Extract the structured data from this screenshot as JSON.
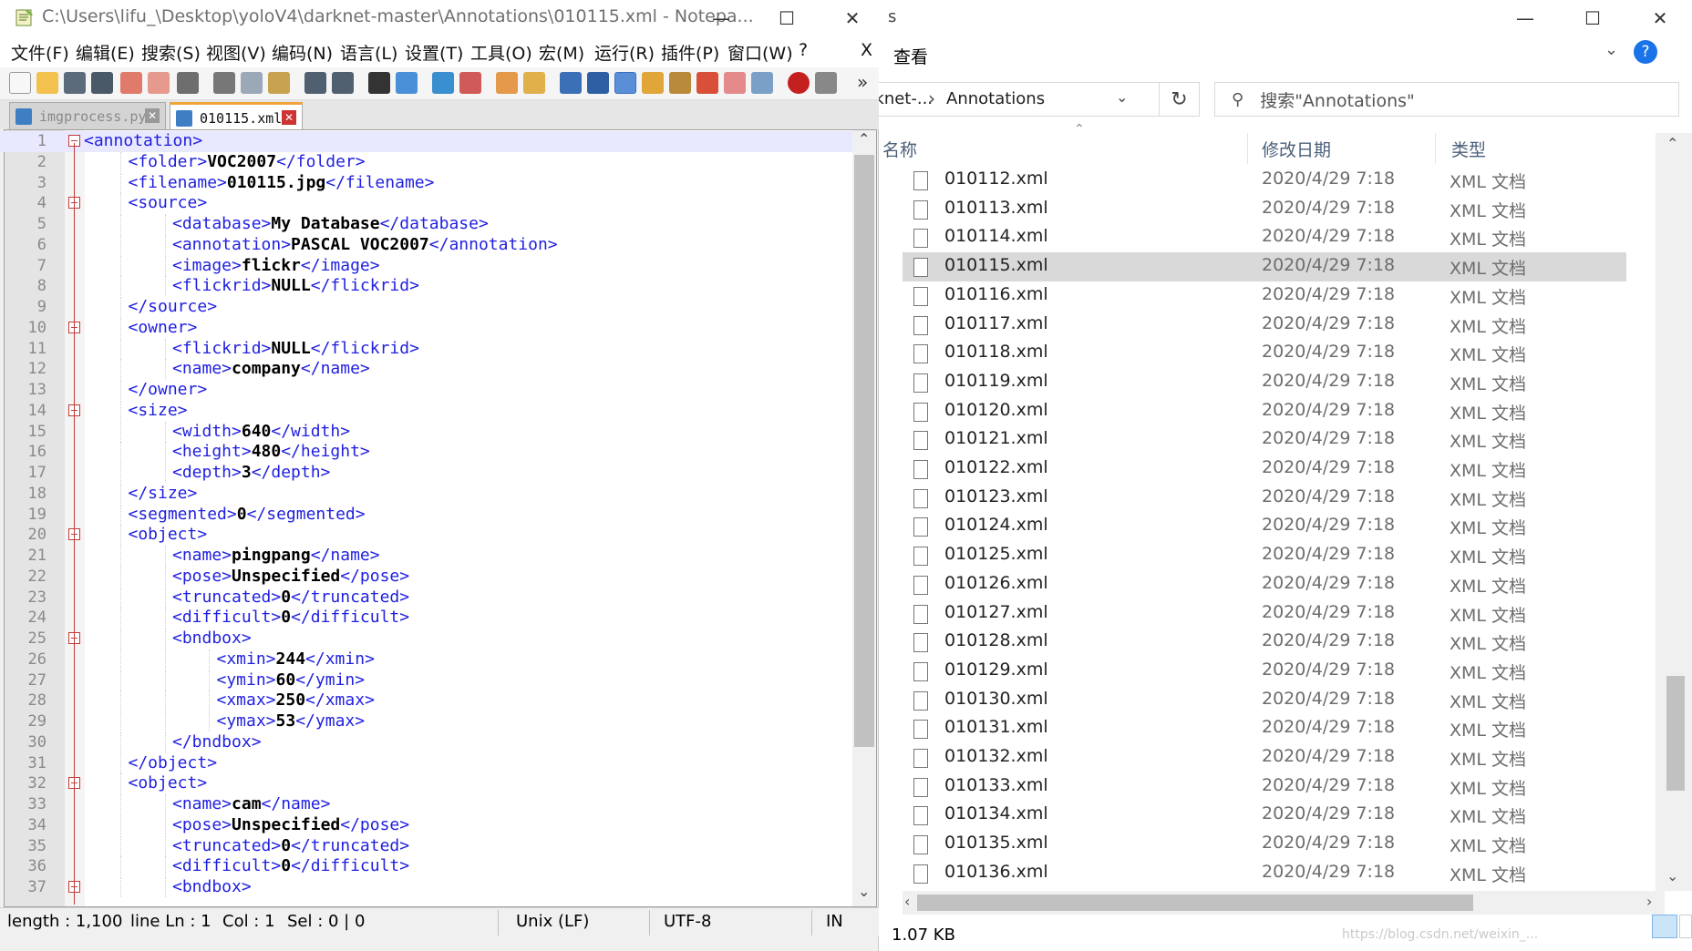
{
  "notepad": {
    "title": "C:\\Users\\lifu_\\Desktop\\yoloV4\\darknet-master\\Annotations\\010115.xml - Notepa...",
    "menu": [
      "文件(F)",
      "编辑(E)",
      "搜索(S)",
      "视图(V)",
      "编码(N)",
      "语言(L)",
      "设置(T)",
      "工具(O)",
      "宏(M)",
      "运行(R)",
      "插件(P)",
      "窗口(W)",
      "?"
    ],
    "menu_close": "X",
    "toolbar_overflow": "»",
    "tabs": [
      {
        "label": "imgprocess.py",
        "active": false
      },
      {
        "label": "010115.xml",
        "active": true
      }
    ],
    "lines": [
      {
        "n": "1",
        "open": "<annotation>",
        "val": "",
        "close": "",
        "indent": 0,
        "fold": true
      },
      {
        "n": "2",
        "open": "<folder>",
        "val": "VOC2007",
        "close": "</folder>",
        "indent": 1
      },
      {
        "n": "3",
        "open": "<filename>",
        "val": "010115.jpg",
        "close": "</filename>",
        "indent": 1
      },
      {
        "n": "4",
        "open": "<source>",
        "val": "",
        "close": "",
        "indent": 1,
        "fold": true
      },
      {
        "n": "5",
        "open": "<database>",
        "val": "My Database",
        "close": "</database>",
        "indent": 2
      },
      {
        "n": "6",
        "open": "<annotation>",
        "val": "PASCAL VOC2007",
        "close": "</annotation>",
        "indent": 2
      },
      {
        "n": "7",
        "open": "<image>",
        "val": "flickr",
        "close": "</image>",
        "indent": 2
      },
      {
        "n": "8",
        "open": "<flickrid>",
        "val": "NULL",
        "close": "</flickrid>",
        "indent": 2
      },
      {
        "n": "9",
        "open": "",
        "val": "",
        "close": "</source>",
        "indent": 1
      },
      {
        "n": "10",
        "open": "<owner>",
        "val": "",
        "close": "",
        "indent": 1,
        "fold": true
      },
      {
        "n": "11",
        "open": "<flickrid>",
        "val": "NULL",
        "close": "</flickrid>",
        "indent": 2
      },
      {
        "n": "12",
        "open": "<name>",
        "val": "company",
        "close": "</name>",
        "indent": 2
      },
      {
        "n": "13",
        "open": "",
        "val": "",
        "close": "</owner>",
        "indent": 1
      },
      {
        "n": "14",
        "open": "<size>",
        "val": "",
        "close": "",
        "indent": 1,
        "fold": true
      },
      {
        "n": "15",
        "open": "<width>",
        "val": "640",
        "close": "</width>",
        "indent": 2
      },
      {
        "n": "16",
        "open": "<height>",
        "val": "480",
        "close": "</height>",
        "indent": 2
      },
      {
        "n": "17",
        "open": "<depth>",
        "val": "3",
        "close": "</depth>",
        "indent": 2
      },
      {
        "n": "18",
        "open": "",
        "val": "",
        "close": "</size>",
        "indent": 1
      },
      {
        "n": "19",
        "open": "<segmented>",
        "val": "0",
        "close": "</segmented>",
        "indent": 1
      },
      {
        "n": "20",
        "open": "<object>",
        "val": "",
        "close": "",
        "indent": 1,
        "fold": true
      },
      {
        "n": "21",
        "open": "<name>",
        "val": "pingpang",
        "close": "</name>",
        "indent": 2
      },
      {
        "n": "22",
        "open": "<pose>",
        "val": "Unspecified",
        "close": "</pose>",
        "indent": 2
      },
      {
        "n": "23",
        "open": "<truncated>",
        "val": "0",
        "close": "</truncated>",
        "indent": 2
      },
      {
        "n": "24",
        "open": "<difficult>",
        "val": "0",
        "close": "</difficult>",
        "indent": 2
      },
      {
        "n": "25",
        "open": "<bndbox>",
        "val": "",
        "close": "",
        "indent": 2,
        "fold": true
      },
      {
        "n": "26",
        "open": "<xmin>",
        "val": "244",
        "close": "</xmin>",
        "indent": 3
      },
      {
        "n": "27",
        "open": "<ymin>",
        "val": "60",
        "close": "</ymin>",
        "indent": 3
      },
      {
        "n": "28",
        "open": "<xmax>",
        "val": "250",
        "close": "</xmax>",
        "indent": 3
      },
      {
        "n": "29",
        "open": "<ymax>",
        "val": "53",
        "close": "</ymax>",
        "indent": 3
      },
      {
        "n": "30",
        "open": "",
        "val": "",
        "close": "</bndbox>",
        "indent": 2
      },
      {
        "n": "31",
        "open": "",
        "val": "",
        "close": "</object>",
        "indent": 1
      },
      {
        "n": "32",
        "open": "<object>",
        "val": "",
        "close": "",
        "indent": 1,
        "fold": true
      },
      {
        "n": "33",
        "open": "<name>",
        "val": "cam",
        "close": "</name>",
        "indent": 2
      },
      {
        "n": "34",
        "open": "<pose>",
        "val": "Unspecified",
        "close": "</pose>",
        "indent": 2
      },
      {
        "n": "35",
        "open": "<truncated>",
        "val": "0",
        "close": "</truncated>",
        "indent": 2
      },
      {
        "n": "36",
        "open": "<difficult>",
        "val": "0",
        "close": "</difficult>",
        "indent": 2
      },
      {
        "n": "37",
        "open": "<bndbox>",
        "val": "",
        "close": "",
        "indent": 2,
        "fold": true
      }
    ],
    "status": {
      "length": "length : 1,100",
      "line": "line Ln : 1",
      "col": "Col : 1",
      "sel": "Sel : 0 | 0",
      "eol": "Unix (LF)",
      "encoding": "UTF-8",
      "mode": "IN"
    }
  },
  "explorer": {
    "title_fragment": "s",
    "ribbon_view": "查看",
    "breadcrumb_prev": "rknet-...",
    "breadcrumb_sep": "›",
    "breadcrumb_current": "Annotations",
    "search_placeholder": "搜索\"Annotations\"",
    "columns": {
      "name": "名称",
      "date": "修改日期",
      "type": "类型"
    },
    "files": [
      {
        "name": "010112.xml",
        "date": "2020/4/29 7:18",
        "type": "XML 文档"
      },
      {
        "name": "010113.xml",
        "date": "2020/4/29 7:18",
        "type": "XML 文档"
      },
      {
        "name": "010114.xml",
        "date": "2020/4/29 7:18",
        "type": "XML 文档"
      },
      {
        "name": "010115.xml",
        "date": "2020/4/29 7:18",
        "type": "XML 文档",
        "selected": true
      },
      {
        "name": "010116.xml",
        "date": "2020/4/29 7:18",
        "type": "XML 文档"
      },
      {
        "name": "010117.xml",
        "date": "2020/4/29 7:18",
        "type": "XML 文档"
      },
      {
        "name": "010118.xml",
        "date": "2020/4/29 7:18",
        "type": "XML 文档"
      },
      {
        "name": "010119.xml",
        "date": "2020/4/29 7:18",
        "type": "XML 文档"
      },
      {
        "name": "010120.xml",
        "date": "2020/4/29 7:18",
        "type": "XML 文档"
      },
      {
        "name": "010121.xml",
        "date": "2020/4/29 7:18",
        "type": "XML 文档"
      },
      {
        "name": "010122.xml",
        "date": "2020/4/29 7:18",
        "type": "XML 文档"
      },
      {
        "name": "010123.xml",
        "date": "2020/4/29 7:18",
        "type": "XML 文档"
      },
      {
        "name": "010124.xml",
        "date": "2020/4/29 7:18",
        "type": "XML 文档"
      },
      {
        "name": "010125.xml",
        "date": "2020/4/29 7:18",
        "type": "XML 文档"
      },
      {
        "name": "010126.xml",
        "date": "2020/4/29 7:18",
        "type": "XML 文档"
      },
      {
        "name": "010127.xml",
        "date": "2020/4/29 7:18",
        "type": "XML 文档"
      },
      {
        "name": "010128.xml",
        "date": "2020/4/29 7:18",
        "type": "XML 文档"
      },
      {
        "name": "010129.xml",
        "date": "2020/4/29 7:18",
        "type": "XML 文档"
      },
      {
        "name": "010130.xml",
        "date": "2020/4/29 7:18",
        "type": "XML 文档"
      },
      {
        "name": "010131.xml",
        "date": "2020/4/29 7:18",
        "type": "XML 文档"
      },
      {
        "name": "010132.xml",
        "date": "2020/4/29 7:18",
        "type": "XML 文档"
      },
      {
        "name": "010133.xml",
        "date": "2020/4/29 7:18",
        "type": "XML 文档"
      },
      {
        "name": "010134.xml",
        "date": "2020/4/29 7:18",
        "type": "XML 文档"
      },
      {
        "name": "010135.xml",
        "date": "2020/4/29 7:18",
        "type": "XML 文档"
      },
      {
        "name": "010136.xml",
        "date": "2020/4/29 7:18",
        "type": "XML 文档"
      }
    ],
    "status_size": "1.07 KB",
    "watermark": "https://blog.csdn.net/weixin_..."
  },
  "colors": {
    "tag_blue": "#1f1fe0",
    "fold_red": "#c23b3b",
    "selection_gray": "#d9d9d9",
    "help_blue": "#1a73e8"
  }
}
